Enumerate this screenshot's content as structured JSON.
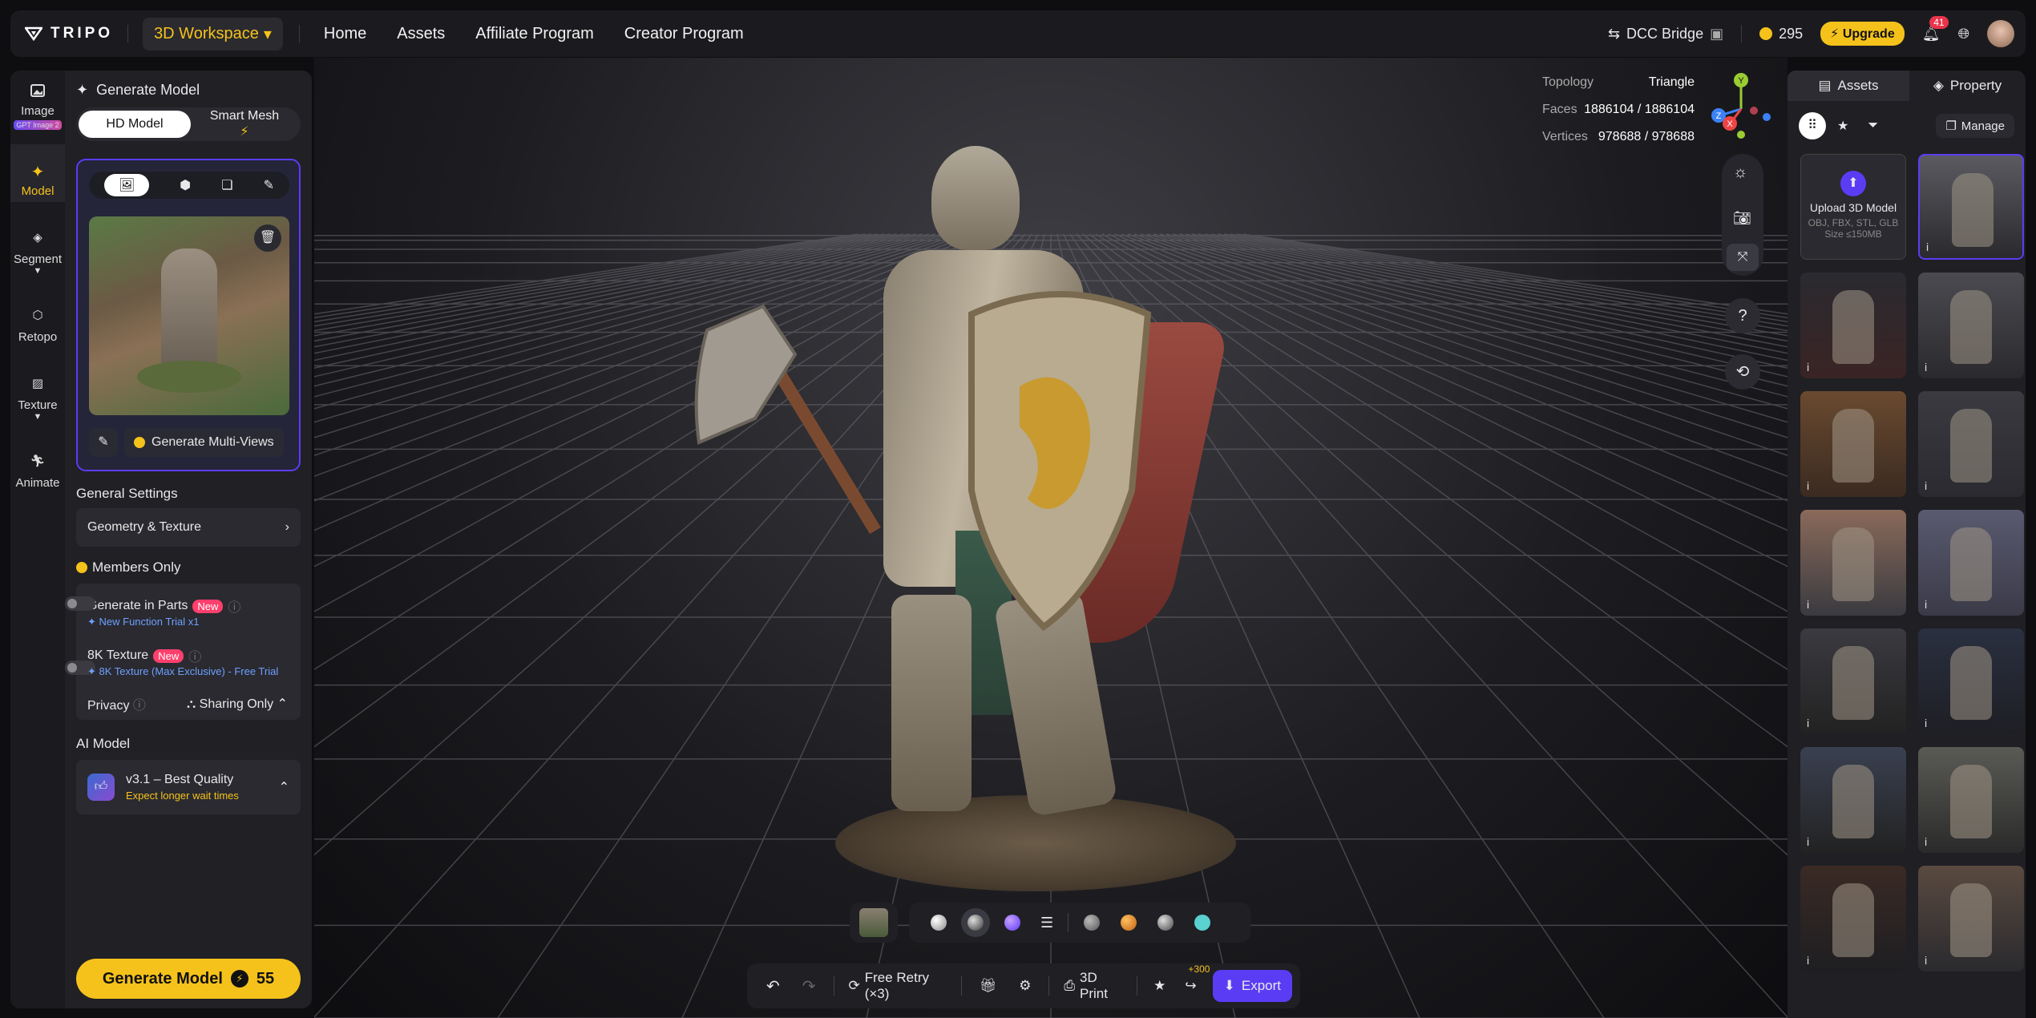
{
  "app": {
    "name": "TRIPO",
    "workspace": "3D Workspace"
  },
  "nav": [
    "Home",
    "Assets",
    "Affiliate Program",
    "Creator Program"
  ],
  "top_right": {
    "dcc": "DCC Bridge",
    "credits": "295",
    "upgrade": "Upgrade",
    "notifications": "41"
  },
  "left_nav": [
    {
      "label": "Image",
      "sub": "GPT Image 2"
    },
    {
      "label": "Model"
    },
    {
      "label": "Segment"
    },
    {
      "label": "Retopo"
    },
    {
      "label": "Texture"
    },
    {
      "label": "Animate"
    }
  ],
  "panel": {
    "title": "Generate Model",
    "modes": [
      "HD Model",
      "Smart Mesh"
    ],
    "multiview": "Generate Multi-Views",
    "general_settings": "General Settings",
    "geometry": "Geometry & Texture",
    "members": "Members Only",
    "parts_label": "Generate in Parts",
    "parts_new": "New",
    "parts_trial": "New Function Trial x1",
    "tex_label": "8K Texture",
    "tex_new": "New",
    "tex_trial": "8K Texture (Max Exclusive) - Free Trial",
    "privacy": "Privacy",
    "privacy_value": "Sharing Only",
    "ai_model": "AI Model",
    "model_name": "v3.1 – Best Quality",
    "model_note": "Expect longer wait times",
    "generate": "Generate Model",
    "generate_cost": "55"
  },
  "stats": {
    "topology_label": "Topology",
    "topology": "Triangle",
    "faces_label": "Faces",
    "faces": "1886104 / 1886104",
    "vertices_label": "Vertices",
    "vertices": "978688 / 978688"
  },
  "axes": {
    "y": "Y",
    "z": "Z",
    "x": "X"
  },
  "bottom": {
    "retry": "Free Retry (×3)",
    "print": "3D Print",
    "plus": "+300",
    "export": "Export"
  },
  "assets": {
    "tab1": "Assets",
    "tab2": "Property",
    "manage": "Manage",
    "upload_title": "Upload 3D Model",
    "upload_formats": "OBJ, FBX, STL, GLB",
    "upload_size": "Size ≤150MB"
  },
  "colors": {
    "accent": "#f5c21b",
    "purple": "#5b3cf5",
    "bg": "#1b1b1f"
  }
}
